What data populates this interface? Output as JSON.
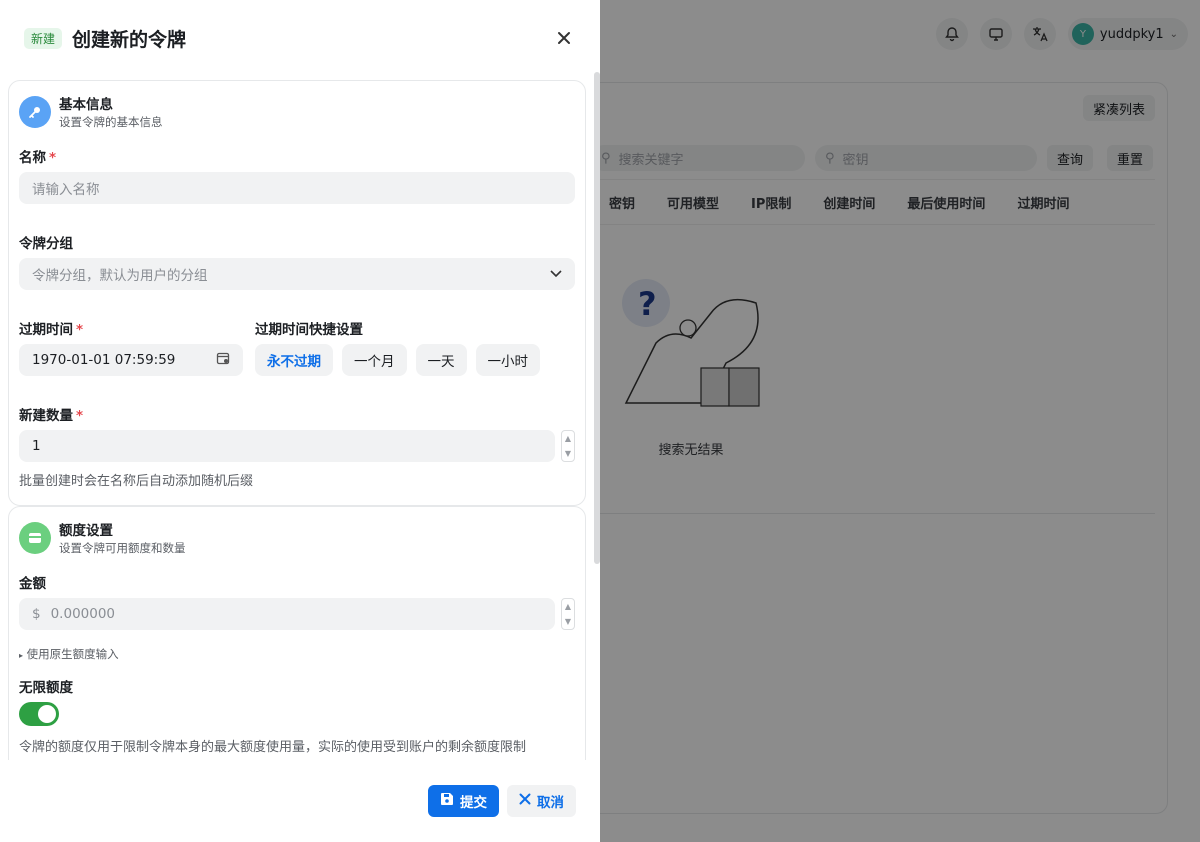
{
  "background": {
    "user_initial": "Y",
    "username": "yuddpky1",
    "compact_button": "紧凑列表",
    "search_placeholder": "搜索关键字",
    "key_placeholder": "密钥",
    "query_button": "查询",
    "reset_button": "重置",
    "table_columns": [
      "密钥",
      "可用模型",
      "IP限制",
      "创建时间",
      "最后使用时间",
      "过期时间"
    ],
    "empty_text": "搜索无结果"
  },
  "sheet": {
    "tag": "新建",
    "title": "创建新的令牌",
    "basic": {
      "title": "基本信息",
      "subtitle": "设置令牌的基本信息",
      "name_label": "名称",
      "name_placeholder": "请输入名称",
      "group_label": "令牌分组",
      "group_placeholder": "令牌分组，默认为用户的分组",
      "expire_label": "过期时间",
      "expire_value": "1970-01-01 07:59:59",
      "quick_label": "过期时间快捷设置",
      "quick_options": [
        "永不过期",
        "一个月",
        "一天",
        "一小时"
      ],
      "count_label": "新建数量",
      "count_value": "1",
      "count_hint": "批量创建时会在名称后自动添加随机后缀"
    },
    "quota": {
      "title": "额度设置",
      "subtitle": "设置令牌可用额度和数量",
      "amount_label": "金额",
      "currency": "$",
      "amount_placeholder": "0.000000",
      "raw_toggle": "使用原生额度输入",
      "unlimited_label": "无限额度",
      "unlimited_on": true,
      "unlimited_hint": "令牌的额度仅用于限制令牌本身的最大额度使用量，实际的使用受到账户的剩余额度限制"
    },
    "submit": "提交",
    "cancel": "取消"
  },
  "colors": {
    "primary": "#0e6fe8",
    "toggle_on": "#2ea043",
    "required": "#e5484d"
  }
}
